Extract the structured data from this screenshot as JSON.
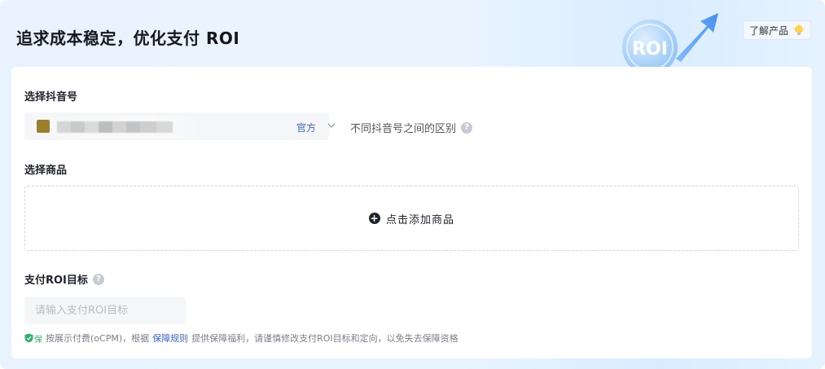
{
  "header": {
    "title": "追求成本稳定，优化支付 ROI",
    "hero_text": "ROI",
    "learn_button": "了解产品"
  },
  "account": {
    "section_label": "选择抖音号",
    "official_tag": "官方",
    "diff_link": "不同抖音号之间的区别"
  },
  "product": {
    "section_label": "选择商品",
    "add_label": "点击添加商品"
  },
  "roi": {
    "section_label": "支付ROI目标",
    "input_placeholder": "请输入支付ROI目标",
    "input_value": "",
    "shield_text": "保",
    "note_prefix": "按展示付费(oCPM)，根据",
    "rule_link": "保障规则",
    "note_suffix": "提供保障福利，请谨慎修改支付ROI目标和定向，以免失去保障资格"
  },
  "colors": {
    "accent": "#3a64d6",
    "shield": "#2fae6c",
    "header_bg": "#e9f3ff"
  }
}
